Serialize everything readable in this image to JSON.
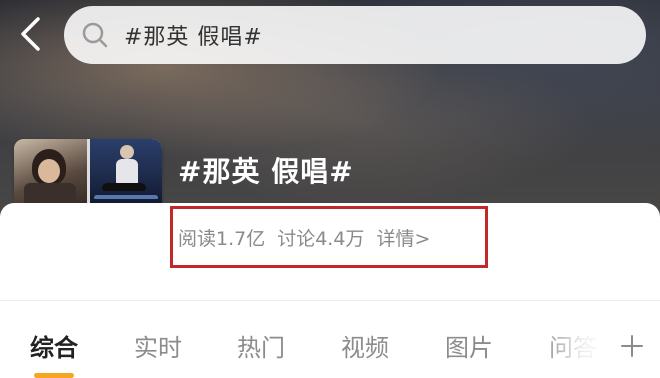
{
  "search": {
    "query": "#那英 假唱#"
  },
  "topic": {
    "title": "#那英 假唱#",
    "stats": {
      "reads": "阅读1.7亿",
      "discussions": "讨论4.4万",
      "details": "详情>"
    }
  },
  "tabs": [
    {
      "label": "综合"
    },
    {
      "label": "实时"
    },
    {
      "label": "热门"
    },
    {
      "label": "视频"
    },
    {
      "label": "图片"
    },
    {
      "label": "问答"
    }
  ],
  "colors": {
    "accent": "#f5a623",
    "highlight_border": "#c0282c"
  },
  "icons": {
    "back": "chevron-left-icon",
    "search": "search-icon",
    "add": "plus-icon"
  }
}
